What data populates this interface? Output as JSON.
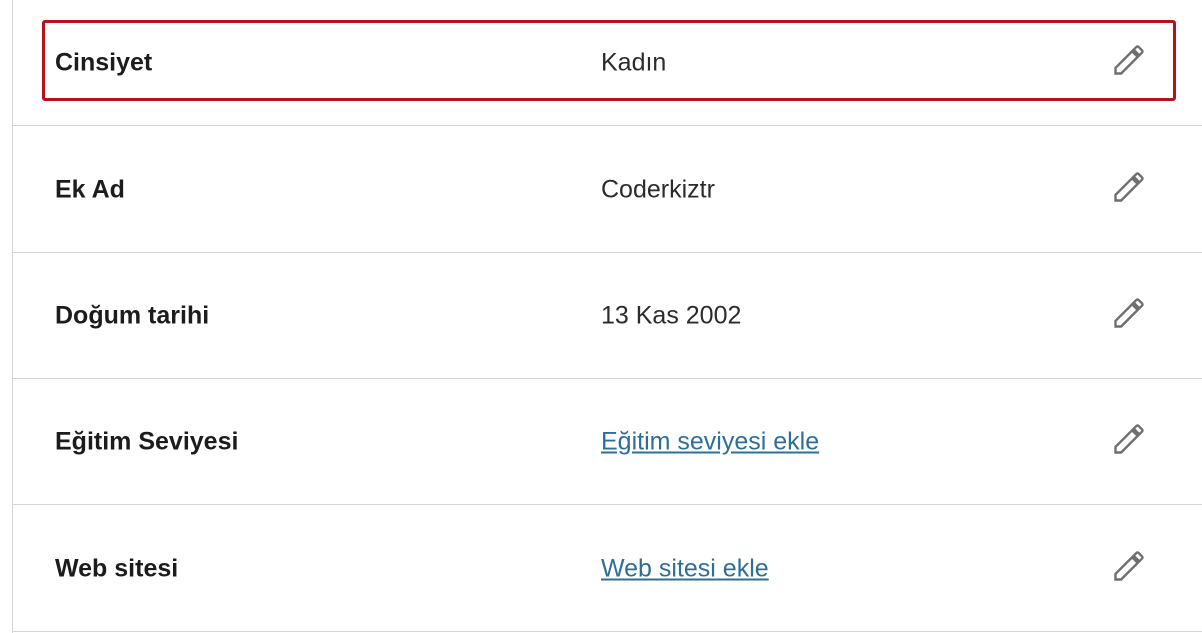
{
  "profile_fields": [
    {
      "label": "Cinsiyet",
      "value": "Kadın",
      "type": "text",
      "icon": "pencil-icon"
    },
    {
      "label": "Ek Ad",
      "value": "Coderkiztr",
      "type": "text",
      "icon": "pencil-icon"
    },
    {
      "label": "Doğum tarihi",
      "value": "13 Kas 2002",
      "type": "text",
      "icon": "pencil-icon"
    },
    {
      "label": "Eğitim Seviyesi",
      "value": "Eğitim seviyesi ekle",
      "type": "link",
      "icon": "pencil-icon"
    },
    {
      "label": "Web sitesi",
      "value": "Web sitesi ekle",
      "type": "link",
      "icon": "pencil-icon"
    }
  ],
  "colors": {
    "highlight_border": "#b5121b",
    "link": "#2f6f97",
    "divider": "#d4d4d4"
  }
}
